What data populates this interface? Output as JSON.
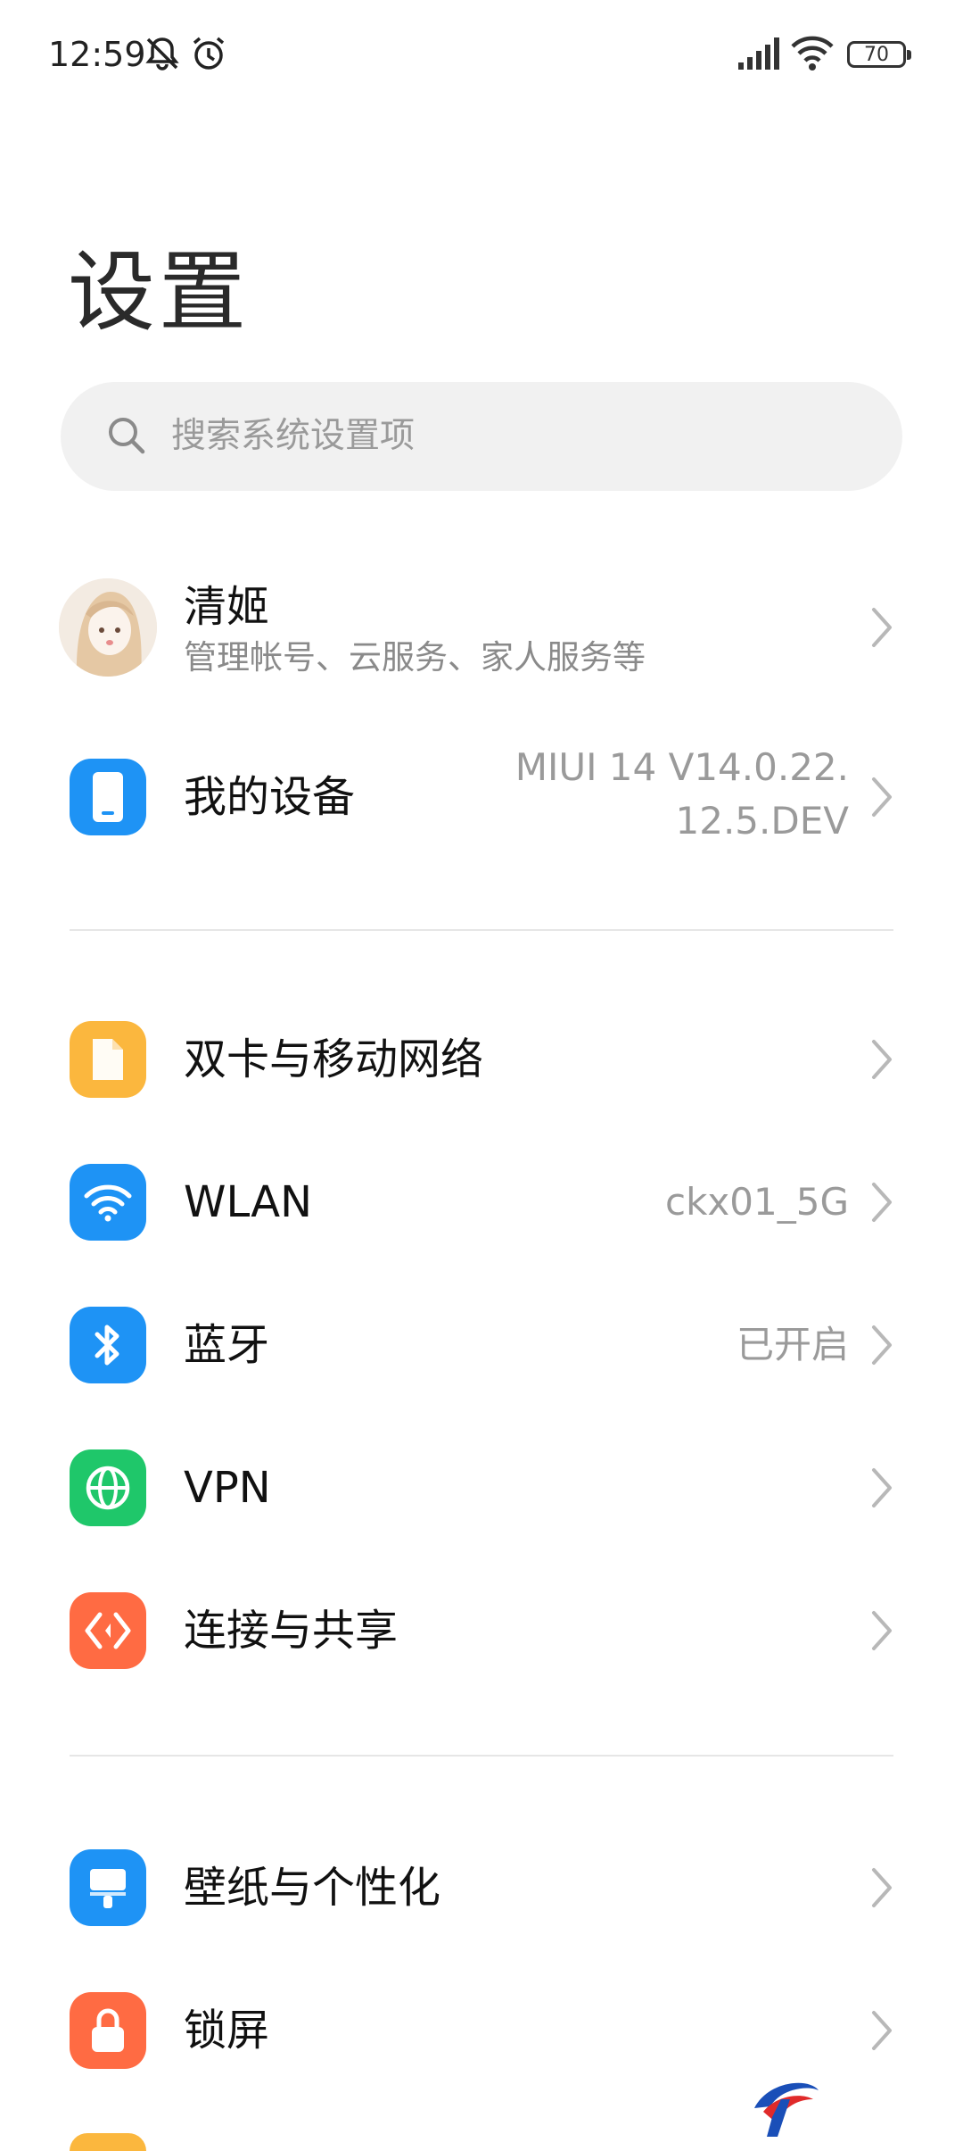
{
  "status_bar": {
    "time": "12:59",
    "battery": "70",
    "icons": [
      "mute-icon",
      "alarm-icon",
      "signal-icon",
      "wifi-icon",
      "battery-icon"
    ]
  },
  "page": {
    "title": "设置"
  },
  "search": {
    "placeholder": "搜索系统设置项"
  },
  "account": {
    "name": "清姬",
    "subtitle": "管理帐号、云服务、家人服务等"
  },
  "my_device": {
    "label": "我的设备",
    "value_line1": "MIUI 14 V14.0.22.",
    "value_line2": "12.5.DEV"
  },
  "items": [
    {
      "label": "双卡与移动网络",
      "value": "",
      "icon": "sim-card-icon",
      "color": "#FBB73E"
    },
    {
      "label": "WLAN",
      "value": "ckx01_5G",
      "icon": "wifi-icon",
      "color": "#1E93F5"
    },
    {
      "label": "蓝牙",
      "value": "已开启",
      "icon": "bluetooth-icon",
      "color": "#1E93F5"
    },
    {
      "label": "VPN",
      "value": "",
      "icon": "globe-icon",
      "color": "#1FC76A"
    },
    {
      "label": "连接与共享",
      "value": "",
      "icon": "share-icon",
      "color": "#FF6B43"
    },
    {
      "label": "壁纸与个性化",
      "value": "",
      "icon": "brush-icon",
      "color": "#1E93F5"
    },
    {
      "label": "锁屏",
      "value": "",
      "icon": "lock-icon",
      "color": "#FF6B43"
    }
  ],
  "colors": {
    "device_icon": "#1E93F5",
    "partial_item": "#FBB73E"
  }
}
